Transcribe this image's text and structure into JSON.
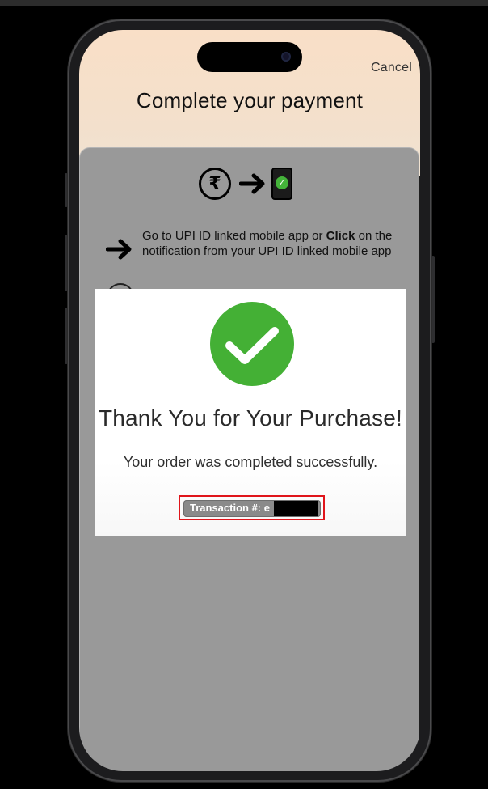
{
  "header": {
    "cancel_label": "Cancel",
    "title": "Complete your payment"
  },
  "sheet": {
    "flow_icons": [
      "rupee-icon",
      "arrow-right-icon",
      "mobile-check-icon"
    ],
    "step1": {
      "text_before": "Go to UPI ID linked mobile app or ",
      "bold": "Click",
      "text_after": " on the notification from your UPI ID linked mobile app"
    }
  },
  "success": {
    "title": "Thank You for Your Purchase!",
    "message": "Your order was completed successfully.",
    "transaction_label": "Transaction #: e"
  },
  "colors": {
    "success_green": "#44b035",
    "highlight_red": "#e0151b",
    "overlay_gray": "#999999"
  }
}
